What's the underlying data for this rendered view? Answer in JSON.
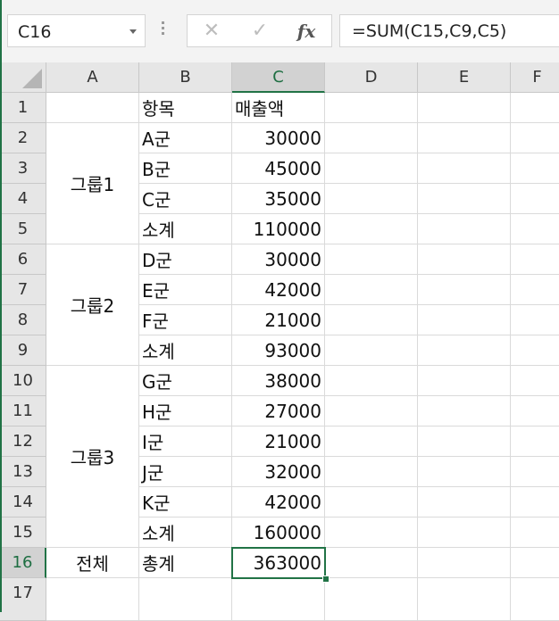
{
  "name_box": {
    "value": "C16"
  },
  "formula_bar": {
    "cancel_icon": "✕",
    "enter_icon": "✓",
    "fx_label": "fx",
    "formula": "=SUM(C15,C9,C5)"
  },
  "columns": [
    "A",
    "B",
    "C",
    "D",
    "E",
    "F"
  ],
  "rows": [
    "1",
    "2",
    "3",
    "4",
    "5",
    "6",
    "7",
    "8",
    "9",
    "10",
    "11",
    "12",
    "13",
    "14",
    "15",
    "16",
    "17"
  ],
  "selected": {
    "column": "C",
    "row": "16"
  },
  "cells": {
    "B1": "항목",
    "C1": "매출액",
    "B2": "A군",
    "C2": "30000",
    "B3": "B군",
    "C3": "45000",
    "B4": "C군",
    "C4": "35000",
    "B5": "소계",
    "C5": "110000",
    "B6": "D군",
    "C6": "30000",
    "B7": "E군",
    "C7": "42000",
    "B8": "F군",
    "C8": "21000",
    "B9": "소계",
    "C9": "93000",
    "B10": "G군",
    "C10": "38000",
    "B11": "H군",
    "C11": "27000",
    "B12": "I군",
    "C12": "21000",
    "B13": "J군",
    "C13": "32000",
    "B14": "K군",
    "C14": "42000",
    "B15": "소계",
    "C15": "160000",
    "A16": "전체",
    "B16": "총계",
    "C16": "363000"
  },
  "merged": {
    "group1": "그룹1",
    "group2": "그룹2",
    "group3": "그룹3"
  }
}
